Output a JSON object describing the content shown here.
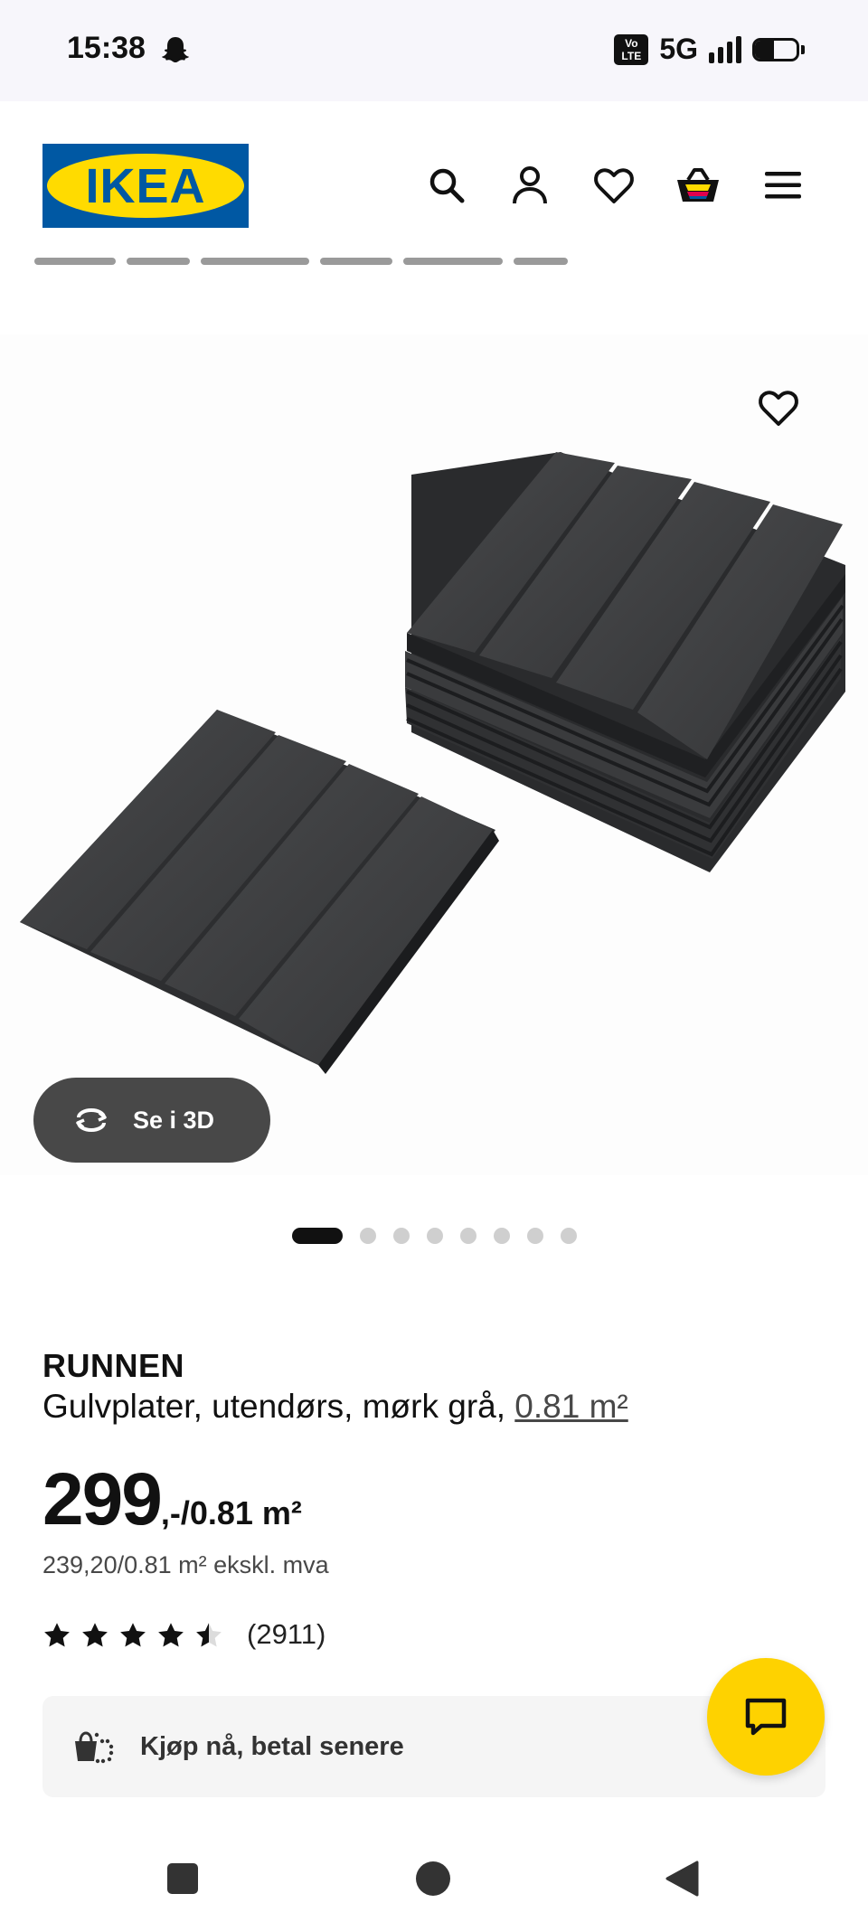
{
  "status_bar": {
    "time": "15:38",
    "network": "5G",
    "volte_label_top": "Vo",
    "volte_label_bottom": "LTE",
    "battery_level": 0.45
  },
  "header": {
    "logo_text": "IKEA",
    "logo_reg": "®",
    "icons": [
      "search-icon",
      "account-icon",
      "wishlist-icon",
      "cart-icon",
      "menu-icon"
    ]
  },
  "gallery": {
    "view3d_label": "Se i 3D",
    "total_images": 8,
    "active_index": 0
  },
  "product": {
    "brand": "RUNNEN",
    "description": "Gulvplater, utendørs, mørk grå, ",
    "size_link": "0.81 m²",
    "price_main": "299",
    "price_unit": ",-/0.81 m²",
    "price_ex_vat": "239,20/0.81 m² ekskl. mva",
    "rating_value": 4.5,
    "rating_max": 5,
    "review_count": "(2911)"
  },
  "payment": {
    "label": "Kjøp nå, betal senere"
  },
  "colors": {
    "ikea_blue": "#0058a3",
    "ikea_yellow": "#ffdb00",
    "chat_yellow": "#fed200",
    "tile_gray": "#3c3d3f"
  }
}
